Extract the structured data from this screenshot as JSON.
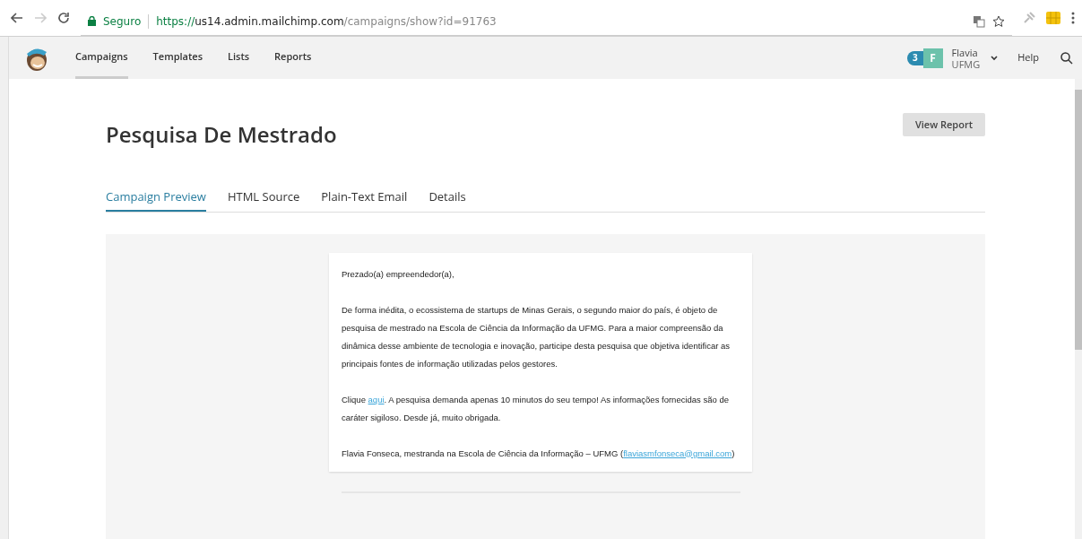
{
  "browser": {
    "security_label": "Seguro",
    "url": {
      "scheme": "https://",
      "host": "us14.admin.mailchimp.com",
      "path": "/campaigns/show?id=91763"
    }
  },
  "nav": {
    "items": [
      {
        "label": "Campaigns",
        "selected": true
      },
      {
        "label": "Templates",
        "selected": false
      },
      {
        "label": "Lists",
        "selected": false
      },
      {
        "label": "Reports",
        "selected": false
      }
    ],
    "notification_count": "3",
    "avatar_letter": "F",
    "user_name": "Flavia",
    "user_org": "UFMG",
    "help": "Help"
  },
  "page": {
    "title": "Pesquisa De Mestrado",
    "view_report": "View Report"
  },
  "tabs": [
    {
      "label": "Campaign Preview",
      "selected": true
    },
    {
      "label": "HTML Source",
      "selected": false
    },
    {
      "label": "Plain-Text Email",
      "selected": false
    },
    {
      "label": "Details",
      "selected": false
    }
  ],
  "email": {
    "paragraphs": [
      {
        "before": "Prezado(a) empreendedor(a),"
      },
      {
        "before": "De forma inédita, o ecossistema de startups de Minas Gerais, o segundo maior do país, é objeto de pesquisa de mestrado na Escola de Ciência da Informação da UFMG. Para a maior compreensão da dinâmica desse ambiente de tecnologia e inovação, participe desta pesquisa que objetiva identificar as principais fontes de informação utilizadas pelos gestores."
      },
      {
        "before": "Clique ",
        "link": "aqui",
        "after": ". A pesquisa demanda apenas 10 minutos do seu tempo! As informações fornecidas são de caráter sigiloso. Desde já, muito obrigada."
      },
      {
        "before": "Flavia Fonseca, mestranda na Escola de Ciência da Informação – UFMG (",
        "link": "flaviasmfonseca@gmail.com",
        "after": ")"
      }
    ]
  }
}
